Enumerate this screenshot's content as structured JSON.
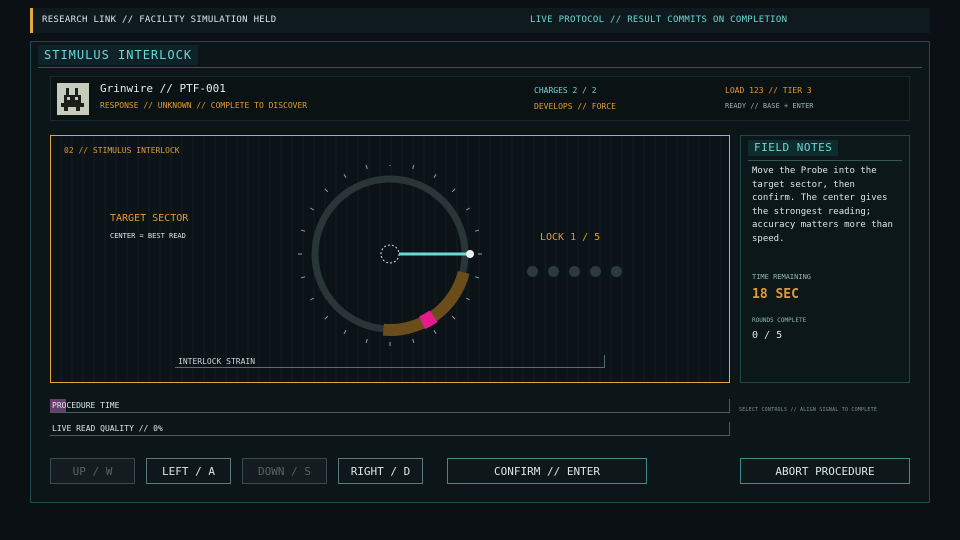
{
  "topbar": {
    "left": "RESEARCH LINK // FACILITY SIMULATION HELD",
    "right": "LIVE PROTOCOL // RESULT COMMITS ON COMPLETION"
  },
  "panel_title": "STIMULUS INTERLOCK",
  "specimen": {
    "name": "Grinwire // PTF-001",
    "response": "RESPONSE // UNKNOWN // COMPLETE TO DISCOVER",
    "charges": "CHARGES 2 / 2",
    "develops": "DEVELOPS // FORCE",
    "load": "LOAD 123 // TIER 3",
    "ready": "READY // BASE + ENTER"
  },
  "arena": {
    "title": "02 // STIMULUS INTERLOCK",
    "target_label": "TARGET SECTOR",
    "target_sub": "CENTER = BEST READ",
    "lock_label": "LOCK 1 / 5",
    "locks_total": 5,
    "locks_done": 0,
    "strain_label": "INTERLOCK STRAIN"
  },
  "notes": {
    "title": "FIELD NOTES",
    "text": "Move the Probe into the target sector, then confirm. The center gives the strongest reading; accuracy matters more than speed.",
    "time_label": "TIME REMAINING",
    "time_value": "18 SEC",
    "rounds_label": "ROUNDS COMPLETE",
    "rounds_value": "0 / 5"
  },
  "bars": {
    "procedure_label": "PROCEDURE TIME",
    "procedure_progress": 0.024,
    "quality_label": "LIVE READ QUALITY // 0%",
    "quality_progress": 0.0
  },
  "side_hint": "SELECT CONTROLS // ALIGN SIGNAL TO COMPLETE",
  "controls": {
    "up": "UP / W",
    "left": "LEFT / A",
    "down": "DOWN / S",
    "right": "RIGHT / D",
    "confirm": "CONFIRM // ENTER",
    "abort": "ABORT PROCEDURE"
  },
  "colors": {
    "accent_orange": "#e39a34",
    "accent_teal": "#69d9d6",
    "target_magenta": "#e41b8a",
    "sector_brown": "#6b4d1c"
  }
}
